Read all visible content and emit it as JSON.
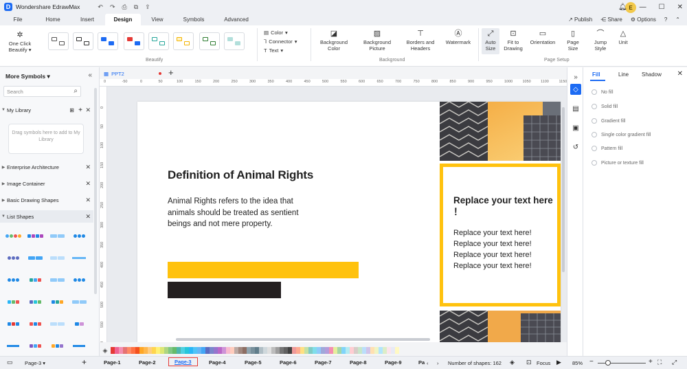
{
  "app": {
    "title": "Wondershare EdrawMax",
    "logo_letter": "D",
    "user_initial": "E"
  },
  "quick": {
    "undo": "↶",
    "redo": "↷",
    "save": "⎙",
    "open": "⧉",
    "share": "⇪"
  },
  "menu": {
    "tabs": [
      "File",
      "Home",
      "Insert",
      "Design",
      "View",
      "Symbols",
      "Advanced"
    ],
    "active": "Design",
    "right": {
      "publish": "Publish",
      "share": "Share",
      "options": "Options",
      "help": "?"
    }
  },
  "ribbon": {
    "one_click": "One Click Beautify",
    "beautify_label": "Beautify",
    "color": "Color",
    "connector": "Connector",
    "text": "Text",
    "background_color": "Background Color",
    "background_picture": "Background Picture",
    "borders_headers": "Borders and Headers",
    "watermark": "Watermark",
    "background_label": "Background",
    "auto_size": "Auto Size",
    "fit_to_drawing": "Fit to Drawing",
    "orientation": "Orientation",
    "page_size": "Page Size",
    "jump_style": "Jump Style",
    "unit": "Unit",
    "page_setup_label": "Page Setup"
  },
  "left_panel": {
    "title": "More Symbols",
    "search_placeholder": "Search",
    "my_library": "My Library",
    "drag_hint": "Drag symbols here to add to My Library",
    "libraries": [
      "Enterprise Architecture",
      "Image Container",
      "Basic Drawing Shapes",
      "List Shapes"
    ]
  },
  "document": {
    "tab": "PPT2"
  },
  "ruler": {
    "top": [
      "0",
      "-50",
      "0",
      "50",
      "100",
      "150",
      "200",
      "250",
      "300",
      "350",
      "400",
      "450",
      "500",
      "550",
      "600",
      "650",
      "700",
      "750",
      "800",
      "850",
      "900",
      "950",
      "1000",
      "1050",
      "1100",
      "1150"
    ],
    "left": [
      "0",
      "50",
      "100",
      "150",
      "200",
      "250",
      "300",
      "350",
      "400",
      "450",
      "500",
      "550",
      "600"
    ]
  },
  "slide": {
    "title": "Definition of Animal Rights",
    "body": "Animal Rights refers to the idea that animals should be treated as sentient beings and not mere property.",
    "frame_title": "Replace your text here ！",
    "frame_lines": [
      "Replace your text here!",
      "Replace your text here!",
      "Replace your text here!",
      "Replace your text here!"
    ],
    "accent_color": "#ffc20e",
    "dark_color": "#231f20"
  },
  "right_panel": {
    "tabs": [
      "Fill",
      "Line",
      "Shadow"
    ],
    "active_tab": "Fill",
    "fill_options": [
      "No fill",
      "Solid fill",
      "Gradient fill",
      "Single color gradient fill",
      "Pattern fill",
      "Picture or texture fill"
    ]
  },
  "statusbar": {
    "current_page": "Page-3",
    "pages": [
      "Page-1",
      "Page-2",
      "Page-3",
      "Page-4",
      "Page-5",
      "Page-6",
      "Page-7",
      "Page-8",
      "Page-9",
      "Pa"
    ],
    "active_page": "Page-3",
    "shapes": "Number of shapes: 162",
    "focus": "Focus",
    "zoom": "85%"
  },
  "palette": [
    "#e53935",
    "#f06292",
    "#f48fb1",
    "#e57373",
    "#ff8a65",
    "#ff7043",
    "#f4511e",
    "#ffa726",
    "#ffb74d",
    "#ffcc80",
    "#ffd54f",
    "#fff176",
    "#dce775",
    "#aed581",
    "#81c784",
    "#66bb6a",
    "#4db6ac",
    "#4dd0e1",
    "#26c6da",
    "#29b6f6",
    "#4fc3f7",
    "#64b5f6",
    "#42a5f5",
    "#5c6bc0",
    "#7986cb",
    "#9575cd",
    "#ba68c8",
    "#ce93d8",
    "#f8bbd0",
    "#ffccbc",
    "#bcaaa4",
    "#a1887f",
    "#8d6e63",
    "#90a4ae",
    "#78909c",
    "#607d8b",
    "#b0bec5",
    "#cfd8dc",
    "#e0e0e0",
    "#bdbdbd",
    "#9e9e9e",
    "#757575",
    "#616161",
    "#424242",
    "#ef9a9a",
    "#ffab91",
    "#ffe082",
    "#c5e1a5",
    "#80cbc4",
    "#80deea",
    "#90caf9",
    "#9fa8da",
    "#b39ddb",
    "#f48fb1",
    "#e6ee9c",
    "#a5d6a7",
    "#81d4fa",
    "#b2ebf2",
    "#ffcdd2",
    "#d7ccc8",
    "#c8e6c9",
    "#bbdefb",
    "#d1c4e9",
    "#ffe0b2",
    "#f0f4c3",
    "#b3e5fc",
    "#dcedc8",
    "#fce4ec",
    "#e8eaf6",
    "#fff9c4"
  ]
}
